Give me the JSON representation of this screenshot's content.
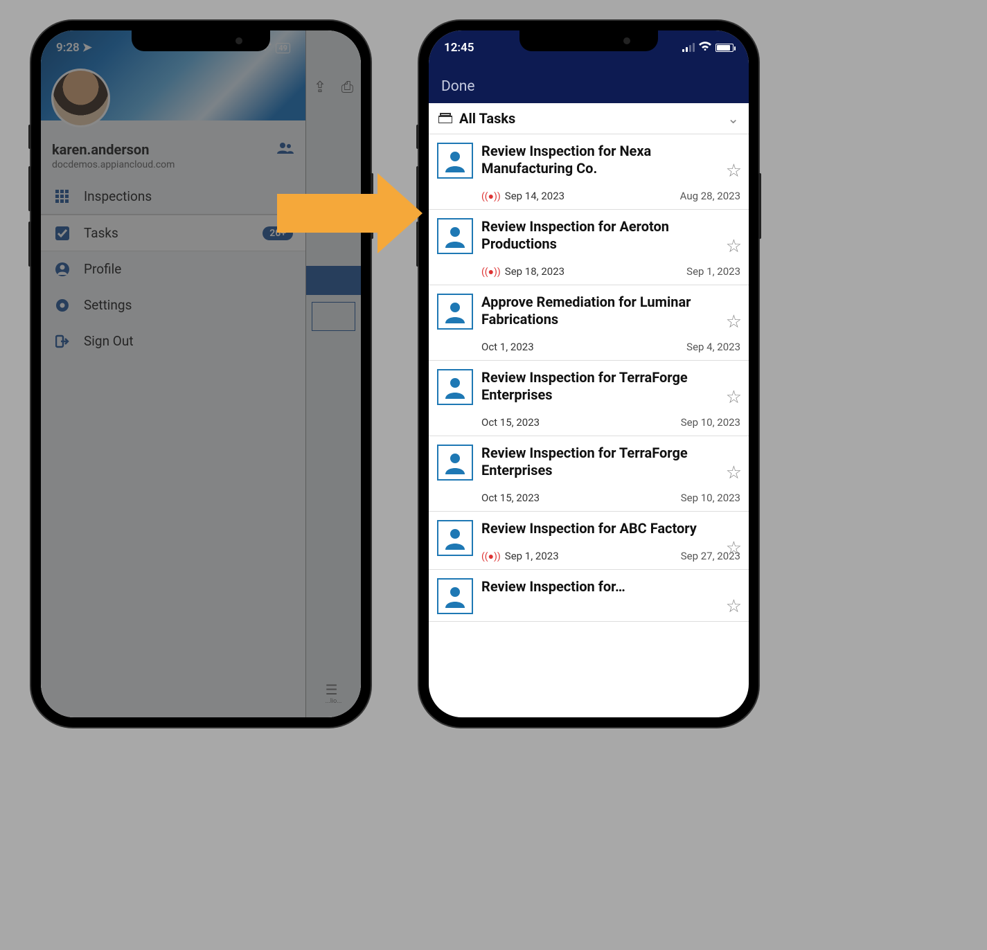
{
  "left": {
    "status": {
      "time": "9:28",
      "battery": "49"
    },
    "user": {
      "name": "karen.anderson",
      "domain": "docdemos.appiancloud.com"
    },
    "menu": {
      "inspections": "Inspections",
      "tasks": "Tasks",
      "tasks_badge": "20+",
      "profile": "Profile",
      "settings": "Settings",
      "signout": "Sign Out"
    }
  },
  "right": {
    "status": {
      "time": "12:45"
    },
    "done": "Done",
    "filter": "All Tasks",
    "tasks": [
      {
        "title": "Review Inspection for Nexa Manufacturing Co.",
        "due": "Sep 14, 2023",
        "received": "Aug 28, 2023",
        "urgent": true
      },
      {
        "title": "Review Inspection for Aeroton Productions",
        "due": "Sep 18, 2023",
        "received": "Sep 1, 2023",
        "urgent": true
      },
      {
        "title": "Approve Remediation for Luminar Fabrications",
        "due": "Oct 1, 2023",
        "received": "Sep 4, 2023",
        "urgent": false
      },
      {
        "title": "Review Inspection for TerraForge Enterprises",
        "due": "Oct 15, 2023",
        "received": "Sep 10, 2023",
        "urgent": false
      },
      {
        "title": "Review Inspection for TerraForge Enterprises",
        "due": "Oct 15, 2023",
        "received": "Sep 10, 2023",
        "urgent": false
      },
      {
        "title": "Review Inspection for ABC Factory",
        "due": "Sep 1, 2023",
        "received": "Sep 27, 2023",
        "urgent": true
      },
      {
        "title": "Review Inspection for…",
        "due": "",
        "received": "",
        "urgent": false
      }
    ]
  }
}
